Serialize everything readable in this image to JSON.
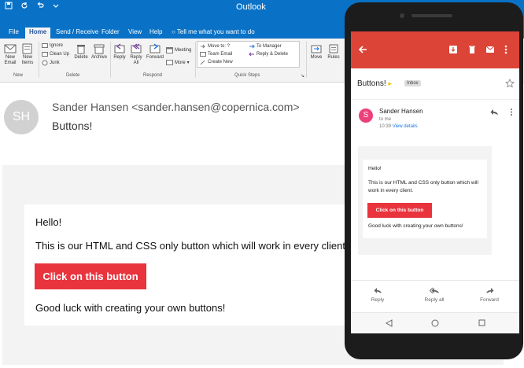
{
  "outlook": {
    "window_title": "Outlook",
    "tabs": [
      "File",
      "Home",
      "Send / Receive",
      "Folder",
      "View",
      "Help"
    ],
    "tell_me": "Tell me what you want to do",
    "ribbon": {
      "new_email": "New Email",
      "new_items": "New Items",
      "ignore": "Ignore",
      "clean_up": "Clean Up",
      "junk": "Junk",
      "delete": "Delete",
      "archive": "Archive",
      "reply": "Reply",
      "reply_all": "Reply All",
      "forward": "Forward",
      "meeting": "Meeting",
      "more": "More",
      "move_to": "Move to: ?",
      "team_email": "Team Email",
      "create_new": "Create New",
      "to_manager": "To Manager",
      "reply_delete": "Reply & Delete",
      "move": "Move",
      "rules": "Rules",
      "groups": [
        "New",
        "Delete",
        "Respond",
        "Quick Steps"
      ]
    },
    "sender_initials": "SH",
    "from": "Sander Hansen <sander.hansen@copernica.com>",
    "subject": "Buttons!",
    "body": {
      "greeting": "Hello!",
      "line1": "This is our HTML and CSS only button which will work in every client.",
      "button_label": "Click on this button",
      "closing": "Good luck with creating your own buttons!"
    }
  },
  "gmail": {
    "subject": "Buttons!",
    "badge": "Inbox",
    "sender_initial": "S",
    "sender_name": "Sander Hansen",
    "to": "to me",
    "time": "10:39",
    "view_details": "View details",
    "body": {
      "greeting": "Hello!",
      "line1": "This is our HTML and CSS only button which will",
      "line2": "work in every client.",
      "button_label": "Click on this button",
      "closing": "Good luck with creating your own buttons!"
    },
    "actions": {
      "reply": "Reply",
      "reply_all": "Reply all",
      "forward": "Forward"
    }
  },
  "colors": {
    "outlook_blue": "#0a72c6",
    "gmail_red": "#db4437",
    "button_red": "#e9343e",
    "avatar_pink": "#ec407a"
  }
}
